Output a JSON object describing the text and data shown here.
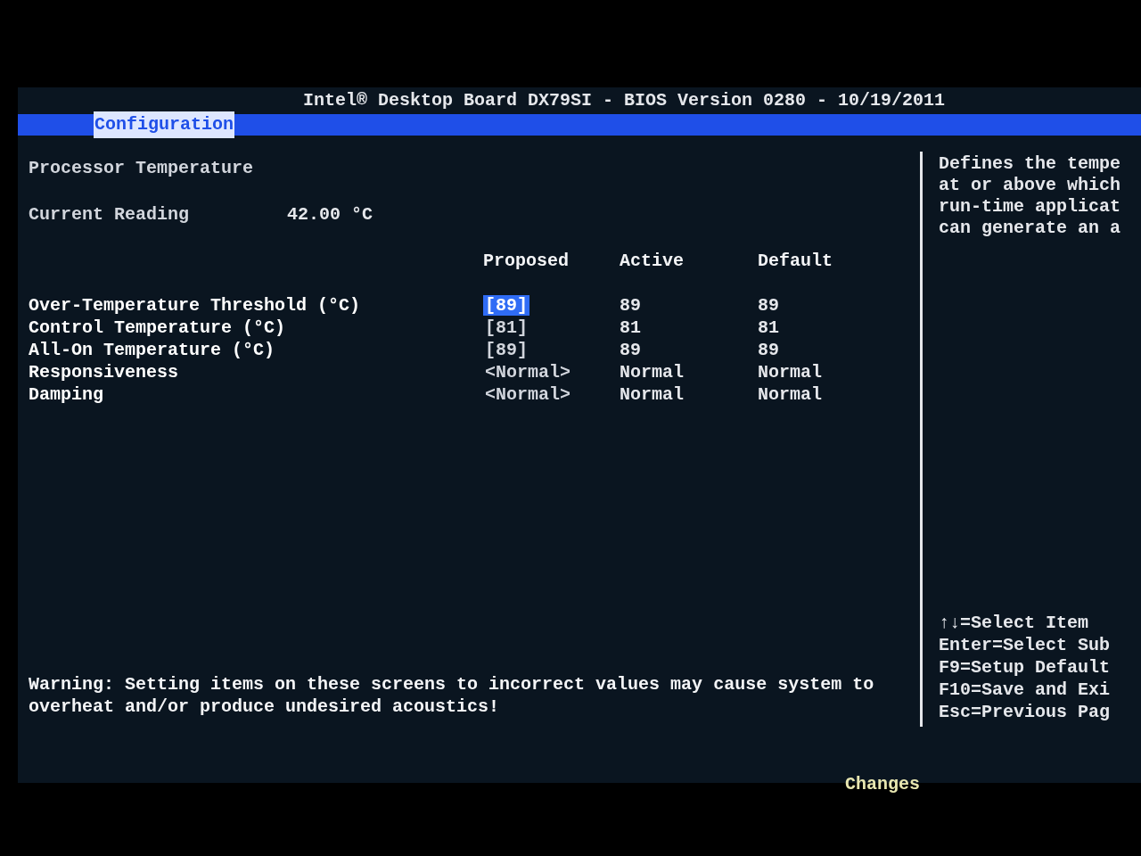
{
  "header": {
    "title": "Intel® Desktop Board DX79SI - BIOS Version 0280 - 10/19/2011"
  },
  "tabs": [
    {
      "label": "Configuration",
      "selected": true
    }
  ],
  "section_title": "Processor Temperature",
  "current_reading": {
    "label": "Current Reading",
    "value": "42.00 °C"
  },
  "table": {
    "columns": [
      "Proposed",
      "Active",
      "Default"
    ],
    "rows": [
      {
        "label": "Over-Temperature Threshold (°C)",
        "proposed": "[89]",
        "active": "89",
        "default": "89",
        "selected": true
      },
      {
        "label": "Control Temperature (°C)",
        "proposed": "[81]",
        "active": "81",
        "default": "81",
        "selected": false
      },
      {
        "label": "All-On Temperature (°C)",
        "proposed": "[89]",
        "active": "89",
        "default": "89",
        "selected": false
      },
      {
        "label": "Responsiveness",
        "proposed": "<Normal>",
        "active": "Normal",
        "default": "Normal",
        "selected": false
      },
      {
        "label": "Damping",
        "proposed": "<Normal>",
        "active": "Normal",
        "default": "Normal",
        "selected": false
      }
    ]
  },
  "warning": "Warning: Setting items on these screens to incorrect values may cause system to overheat and/or produce undesired acoustics!",
  "help": {
    "lines": [
      "Defines the tempe",
      "at or above which",
      "run-time applicat",
      "can generate an a"
    ]
  },
  "keys": [
    "↑↓=Select Item",
    "Enter=Select Sub",
    "F9=Setup Default",
    "F10=Save and Exi",
    "Esc=Previous Pag"
  ],
  "footer": "Changes"
}
